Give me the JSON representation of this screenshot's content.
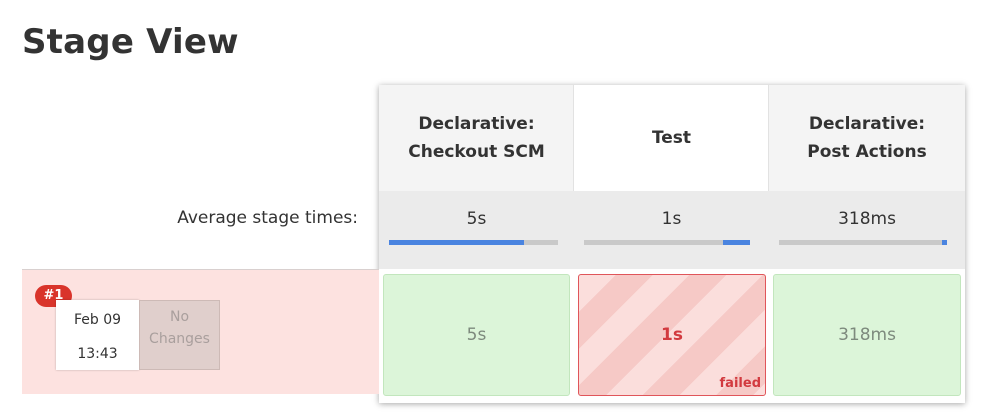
{
  "page": {
    "title": "Stage View"
  },
  "stages": [
    {
      "name_line1": "Declarative:",
      "name_line2": "Checkout SCM",
      "avg_time": "5s",
      "avg_progress": 0.8
    },
    {
      "name_line1": "",
      "name_line2": "Test",
      "avg_time": "1s",
      "avg_progress": 0.16
    },
    {
      "name_line1": "Declarative:",
      "name_line2": "Post Actions",
      "avg_time": "318ms",
      "avg_progress": 0.03
    }
  ],
  "average_label": "Average stage times:",
  "build": {
    "number": "#1",
    "date": "Feb 09",
    "time": "13:43",
    "changes_line1": "No",
    "changes_line2": "Changes",
    "results": [
      {
        "time": "5s",
        "status": "success"
      },
      {
        "time": "1s",
        "status": "failed",
        "status_label": "failed"
      },
      {
        "time": "318ms",
        "status": "success"
      }
    ]
  },
  "colors": {
    "success_bg": "#dcf5d9",
    "failed_border": "#e0555a",
    "progress_fill": "#4a84e0",
    "badge_bg": "#d9342b",
    "build_row_bg": "#fde2e0"
  }
}
